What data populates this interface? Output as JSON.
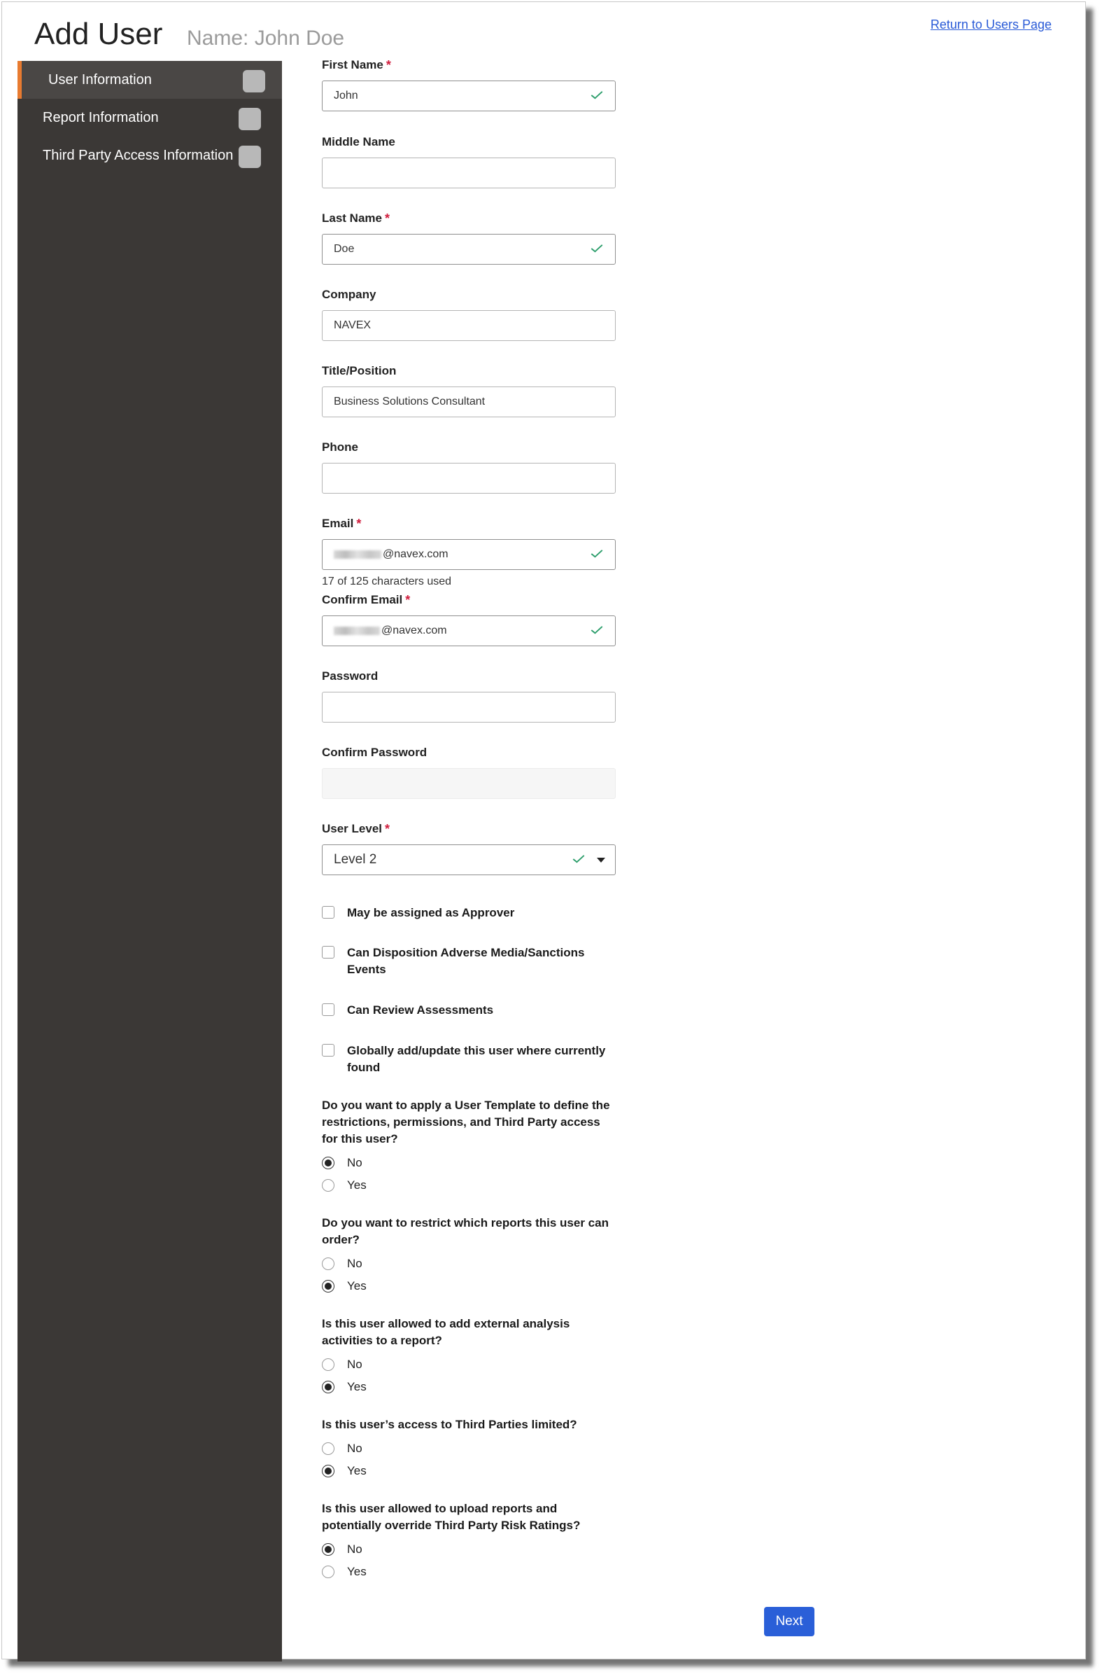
{
  "header": {
    "title": "Add User",
    "name_label": "Name: John Doe",
    "return_link": "Return to Users Page"
  },
  "sidebar": {
    "items": [
      {
        "label": "User Information",
        "active": true
      },
      {
        "label": "Report Information",
        "active": false
      },
      {
        "label": "Third Party Access Information",
        "active": false
      }
    ]
  },
  "form": {
    "first_name": {
      "label": "First Name",
      "value": "John",
      "required": "*"
    },
    "middle_name": {
      "label": "Middle Name",
      "value": ""
    },
    "last_name": {
      "label": "Last Name",
      "value": "Doe",
      "required": "*"
    },
    "company": {
      "label": "Company",
      "value": "NAVEX"
    },
    "title_position": {
      "label": "Title/Position",
      "value": "Business Solutions Consultant"
    },
    "phone": {
      "label": "Phone",
      "value": ""
    },
    "email": {
      "label": "Email",
      "value_suffix": "@navex.com",
      "hint": "17 of 125 characters used",
      "required": "*"
    },
    "confirm_email": {
      "label": "Confirm Email",
      "value_suffix": "@navex.com",
      "required": "*"
    },
    "password": {
      "label": "Password",
      "value": ""
    },
    "confirm_password": {
      "label": "Confirm Password",
      "value": ""
    },
    "user_level": {
      "label": "User Level",
      "value": "Level 2",
      "required": "*"
    }
  },
  "checkboxes": [
    {
      "label": "May be assigned as Approver",
      "checked": false
    },
    {
      "label": "Can Disposition Adverse Media/Sanctions Events",
      "checked": false
    },
    {
      "label": "Can Review Assessments",
      "checked": false
    },
    {
      "label": "Globally add/update this user where currently found",
      "checked": false
    }
  ],
  "questions": [
    {
      "text": "Do you want to apply a User Template to define the restrictions, permissions, and Third Party access for this user?",
      "options": [
        "No",
        "Yes"
      ],
      "selected": "No"
    },
    {
      "text": "Do you want to restrict which reports this user can order?",
      "options": [
        "No",
        "Yes"
      ],
      "selected": "Yes"
    },
    {
      "text": "Is this user allowed to add external analysis activities to a report?",
      "options": [
        "No",
        "Yes"
      ],
      "selected": "Yes"
    },
    {
      "text": "Is this user’s access to Third Parties limited?",
      "options": [
        "No",
        "Yes"
      ],
      "selected": "Yes"
    },
    {
      "text": "Is this user allowed to upload reports and potentially override Third Party Risk Ratings?",
      "options": [
        "No",
        "Yes"
      ],
      "selected": "No"
    }
  ],
  "actions": {
    "next_label": "Next"
  },
  "colors": {
    "accent": "#e87b30",
    "sidebar_bg": "#3b3836",
    "valid_check": "#2a9d6a",
    "primary_button": "#2a5fd8",
    "required": "#d01c3c"
  }
}
